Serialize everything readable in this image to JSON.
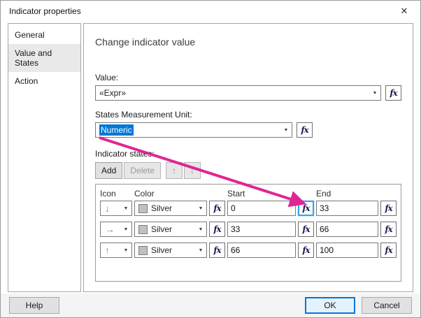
{
  "colors": {
    "accent": "#0078d7",
    "annotation": "#df2695",
    "silver": "#c0c0c0"
  },
  "glyphs": {
    "caret": "▼",
    "up": "↑",
    "down": "↓"
  },
  "fx_label": "fx",
  "dialog": {
    "title": "Indicator properties",
    "close_glyph": "✕"
  },
  "sidebar": {
    "items": [
      {
        "label": "General"
      },
      {
        "label": "Value and States"
      },
      {
        "label": "Action"
      }
    ]
  },
  "main": {
    "heading": "Change indicator value",
    "value": {
      "label": "Value:",
      "selected": "«Expr»"
    },
    "unit": {
      "label": "States Measurement Unit:",
      "selected": "Numeric"
    },
    "states": {
      "label": "Indicator states:",
      "add_label": "Add",
      "delete_label": "Delete"
    },
    "table": {
      "headers": {
        "icon": "Icon",
        "color": "Color",
        "start": "Start",
        "end": "End"
      },
      "rows": [
        {
          "icon": "down-arrow",
          "glyph": "↓",
          "color": "Silver",
          "start": "0",
          "end": "33"
        },
        {
          "icon": "right-arrow",
          "glyph": "→",
          "color": "Silver",
          "start": "33",
          "end": "66"
        },
        {
          "icon": "up-arrow",
          "glyph": "↑",
          "color": "Silver",
          "start": "66",
          "end": "100"
        }
      ]
    }
  },
  "footer": {
    "help": "Help",
    "ok": "OK",
    "cancel": "Cancel"
  }
}
